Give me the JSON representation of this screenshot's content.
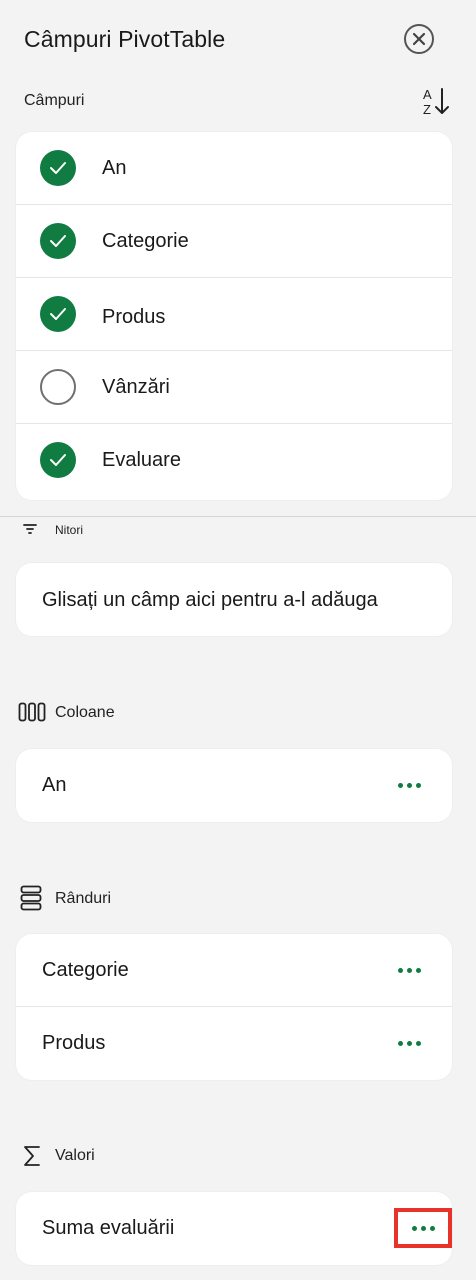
{
  "panel": {
    "title": "Câmpuri PivotTable",
    "fields_label": "Câmpuri"
  },
  "fields": [
    {
      "label": "An",
      "checked": true
    },
    {
      "label": "Categorie",
      "checked": true
    },
    {
      "label": "Produs",
      "checked": true
    },
    {
      "label": "Vânzări",
      "checked": false
    },
    {
      "label": "Evaluare",
      "checked": true
    }
  ],
  "filters": {
    "label": "Nitori",
    "drop_hint": "Glisați un câmp aici pentru a-l adăuga"
  },
  "columns": {
    "label": "Coloane",
    "items": [
      "An"
    ]
  },
  "rows": {
    "label": "Rânduri",
    "items": [
      "Categorie",
      "Produs"
    ]
  },
  "values": {
    "label": "Valori",
    "items": [
      "Suma evaluării"
    ]
  },
  "colors": {
    "accent": "#107c41",
    "highlight": "#e8332a"
  }
}
